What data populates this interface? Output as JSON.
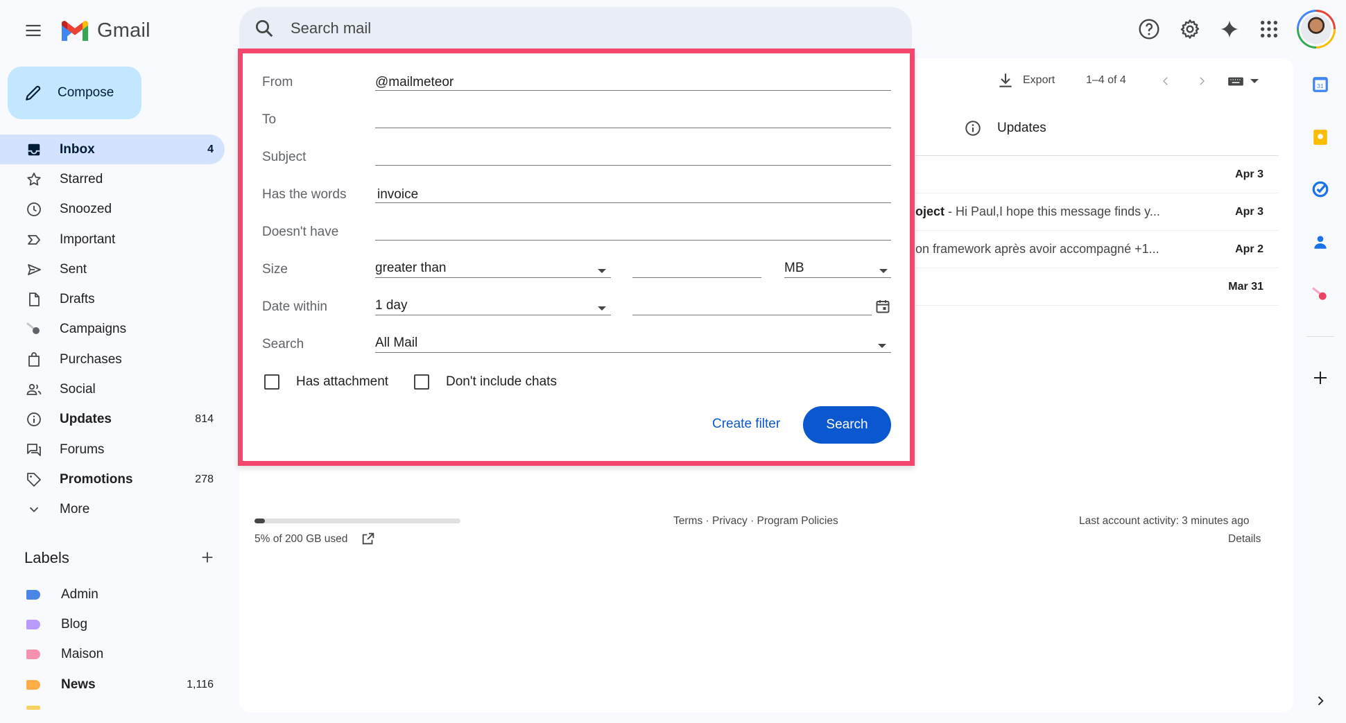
{
  "app": {
    "name": "Gmail",
    "logo_icon": "gmail-m-logo"
  },
  "search": {
    "placeholder": "Search mail"
  },
  "compose": {
    "label": "Compose"
  },
  "sidebar": {
    "items": [
      {
        "label": "Inbox",
        "count": "4",
        "icon": "inbox-icon"
      },
      {
        "label": "Starred",
        "count": "",
        "icon": "star-icon"
      },
      {
        "label": "Snoozed",
        "count": "",
        "icon": "clock-icon"
      },
      {
        "label": "Important",
        "count": "",
        "icon": "important-icon"
      },
      {
        "label": "Sent",
        "count": "",
        "icon": "send-icon"
      },
      {
        "label": "Drafts",
        "count": "",
        "icon": "draft-icon"
      },
      {
        "label": "Campaigns",
        "count": "",
        "icon": "meteor-icon"
      },
      {
        "label": "Purchases",
        "count": "",
        "icon": "shopping-bag-icon"
      },
      {
        "label": "Social",
        "count": "",
        "icon": "people-icon"
      },
      {
        "label": "Updates",
        "count": "814",
        "icon": "info-icon"
      },
      {
        "label": "Forums",
        "count": "",
        "icon": "forum-icon"
      },
      {
        "label": "Promotions",
        "count": "278",
        "icon": "tag-icon"
      },
      {
        "label": "More",
        "count": "",
        "icon": "chevron-down-icon"
      }
    ]
  },
  "labels": {
    "header": "Labels",
    "items": [
      {
        "label": "Admin",
        "count": "",
        "color": "#4a86e8"
      },
      {
        "label": "Blog",
        "count": "",
        "color": "#b99aff"
      },
      {
        "label": "Maison",
        "count": "",
        "color": "#f691b2"
      },
      {
        "label": "News",
        "count": "1,116",
        "color": "#ffad47"
      }
    ]
  },
  "toolbar": {
    "export_label": "Export",
    "pagination": "1–4 of 4"
  },
  "tab": {
    "label": "Updates"
  },
  "emails": [
    {
      "snippet": "",
      "date": "Apr 3"
    },
    {
      "subject_fragment": "oject",
      "snippet": " - Hi Paul,I hope this message finds y...",
      "date": "Apr 3"
    },
    {
      "snippet": "on framework après avoir accompagné +1...",
      "date": "Apr 2"
    },
    {
      "snippet": "",
      "date": "Mar 31"
    }
  ],
  "footer": {
    "storage_text": "5% of 200 GB used",
    "storage_fraction": 0.05,
    "links": "Terms · Privacy · Program Policies",
    "activity": "Last account activity: 3 minutes ago",
    "details": "Details"
  },
  "advanced_search": {
    "from_label": "From",
    "from_value": "@mailmeteor",
    "to_label": "To",
    "to_value": "",
    "subject_label": "Subject",
    "subject_value": "",
    "has_words_label": "Has the words",
    "has_words_value": "invoice",
    "doesnt_have_label": "Doesn't have",
    "doesnt_have_value": "",
    "size_label": "Size",
    "size_operator": "greater than",
    "size_value": "",
    "size_unit": "MB",
    "date_label": "Date within",
    "date_value": "1 day",
    "date_field": "",
    "search_label": "Search",
    "search_scope": "All Mail",
    "has_attachment_label": "Has attachment",
    "has_attachment_checked": false,
    "no_chats_label": "Don't include chats",
    "no_chats_checked": false,
    "create_filter_label": "Create filter",
    "search_button_label": "Search",
    "highlight_color": "#f4476b"
  },
  "colors": {
    "accent": "#0b57d0",
    "active_nav": "#d3e3fd",
    "compose_bg": "#c2e7ff"
  }
}
